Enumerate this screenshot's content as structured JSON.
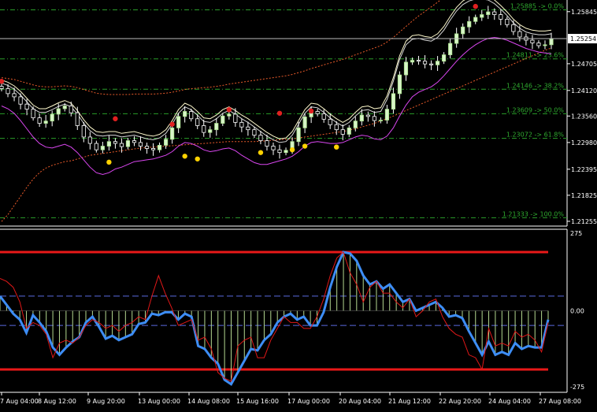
{
  "chart_data": [
    {
      "type": "candlestick",
      "title": "",
      "x_tick_labels": [
        "7 Aug 04:00",
        "8 Aug 12:00",
        "9 Aug 20:00",
        "13 Aug 00:00",
        "14 Aug 08:00",
        "15 Aug 16:00",
        "17 Aug 00:00",
        "20 Aug 04:00",
        "21 Aug 12:00",
        "22 Aug 20:00",
        "24 Aug 04:00",
        "27 Aug 08:00"
      ],
      "y_tick_labels": [
        "1.25845",
        "1.24705",
        "1.24120",
        "1.23560",
        "1.22980",
        "1.22395",
        "1.21825",
        "1.21255"
      ],
      "ylim": [
        1.2115,
        1.261
      ],
      "current_price": "1.25254",
      "fib_levels": [
        {
          "price": 1.25885,
          "label": "1.25885 -> 0.0%"
        },
        {
          "price": 1.24811,
          "label": "1.24811 -> 23.6%"
        },
        {
          "price": 1.24146,
          "label": "1.24146 -> 38.2%"
        },
        {
          "price": 1.23609,
          "label": "1.23609 -> 50.0%"
        },
        {
          "price": 1.23072,
          "label": "1.23072 -> 61.8%"
        },
        {
          "price": 1.21333,
          "label": "1.21333 -> 100.0%"
        }
      ],
      "close_series": [
        1.2416,
        1.2405,
        1.2398,
        1.2382,
        1.2371,
        1.2352,
        1.234,
        1.2345,
        1.236,
        1.2372,
        1.2378,
        1.2363,
        1.2335,
        1.231,
        1.2296,
        1.2282,
        1.229,
        1.23,
        1.2296,
        1.2289,
        1.2302,
        1.2298,
        1.229,
        1.2285,
        1.2282,
        1.2292,
        1.2305,
        1.233,
        1.2355,
        1.2366,
        1.235,
        1.2335,
        1.232,
        1.2326,
        1.234,
        1.2356,
        1.236,
        1.2342,
        1.2332,
        1.2326,
        1.2314,
        1.2302,
        1.229,
        1.2282,
        1.2276,
        1.2281,
        1.23,
        1.233,
        1.2354,
        1.2366,
        1.2361,
        1.2349,
        1.2337,
        1.2326,
        1.2316,
        1.233,
        1.2345,
        1.2358,
        1.2355,
        1.2346,
        1.2347,
        1.2371,
        1.2405,
        1.2446,
        1.2474,
        1.2478,
        1.2476,
        1.247,
        1.2468,
        1.2476,
        1.249,
        1.2515,
        1.2536,
        1.2551,
        1.2563,
        1.2572,
        1.2578,
        1.2584,
        1.2578,
        1.2568,
        1.2556,
        1.2541,
        1.2529,
        1.2522,
        1.2516,
        1.251,
        1.2512,
        1.2525
      ],
      "bollinger_series": [
        {
          "name": "",
          "color": "#fffacd",
          "values": [
            1.2435,
            1.243,
            1.2422,
            1.241,
            1.2395,
            1.238,
            1.2372,
            1.2372,
            1.2378,
            1.2385,
            1.239,
            1.2384,
            1.2368,
            1.2348,
            1.2332,
            1.2322,
            1.232,
            1.2322,
            1.2322,
            1.2318,
            1.232,
            1.2322,
            1.2318,
            1.2314,
            1.2312,
            1.2316,
            1.2326,
            1.2346,
            1.237,
            1.2384,
            1.2378,
            1.2366,
            1.2352,
            1.235,
            1.2358,
            1.237,
            1.2376,
            1.2368,
            1.2358,
            1.235,
            1.234,
            1.233,
            1.232,
            1.2312,
            1.2306,
            1.2308,
            1.2322,
            1.2346,
            1.237,
            1.2384,
            1.2382,
            1.2372,
            1.236,
            1.235,
            1.2342,
            1.235,
            1.2364,
            1.2376,
            1.2378,
            1.2372,
            1.2374,
            1.24,
            1.244,
            1.2488,
            1.252,
            1.2532,
            1.2534,
            1.253,
            1.2528,
            1.2536,
            1.2552,
            1.2574,
            1.2594,
            1.2608,
            1.2616,
            1.262,
            1.262,
            1.2618,
            1.261,
            1.2598,
            1.2584,
            1.2568,
            1.2556,
            1.2548,
            1.2544,
            1.2542,
            1.2542,
            1.2544
          ]
        },
        {
          "name": "",
          "color": "#d9d9d9",
          "values": [
            1.2428,
            1.2423,
            1.2415,
            1.2402,
            1.2387,
            1.2372,
            1.2364,
            1.2364,
            1.237,
            1.2377,
            1.2382,
            1.2376,
            1.236,
            1.234,
            1.2324,
            1.2314,
            1.2312,
            1.2314,
            1.2314,
            1.231,
            1.2312,
            1.2314,
            1.231,
            1.2306,
            1.2304,
            1.2308,
            1.2318,
            1.2338,
            1.2362,
            1.2376,
            1.237,
            1.2358,
            1.2344,
            1.2342,
            1.235,
            1.2362,
            1.2368,
            1.236,
            1.235,
            1.2342,
            1.2332,
            1.2322,
            1.2312,
            1.2304,
            1.2298,
            1.23,
            1.2314,
            1.2338,
            1.2362,
            1.2376,
            1.2374,
            1.2364,
            1.2352,
            1.2342,
            1.2334,
            1.2342,
            1.2356,
            1.2368,
            1.237,
            1.2364,
            1.2366,
            1.2392,
            1.2432,
            1.248,
            1.2512,
            1.2524,
            1.2526,
            1.2522,
            1.252,
            1.2528,
            1.2544,
            1.2566,
            1.2586,
            1.26,
            1.2608,
            1.2612,
            1.2612,
            1.261,
            1.2602,
            1.259,
            1.2576,
            1.256,
            1.2548,
            1.254,
            1.2536,
            1.2534,
            1.2534,
            1.2536
          ]
        },
        {
          "name": "",
          "color": "#d946ef",
          "values": [
            1.2378,
            1.2372,
            1.2362,
            1.2346,
            1.2328,
            1.231,
            1.2296,
            1.2288,
            1.2286,
            1.229,
            1.2294,
            1.2288,
            1.2276,
            1.226,
            1.2244,
            1.2232,
            1.2228,
            1.2232,
            1.224,
            1.2244,
            1.225,
            1.2256,
            1.2258,
            1.226,
            1.2262,
            1.2266,
            1.227,
            1.2278,
            1.229,
            1.2298,
            1.2296,
            1.229,
            1.2282,
            1.2278,
            1.228,
            1.2284,
            1.2286,
            1.228,
            1.227,
            1.2262,
            1.2254,
            1.225,
            1.225,
            1.2254,
            1.2258,
            1.2262,
            1.2268,
            1.2278,
            1.229,
            1.2298,
            1.23,
            1.2298,
            1.2296,
            1.2296,
            1.2298,
            1.2304,
            1.231,
            1.2314,
            1.2312,
            1.2306,
            1.2304,
            1.2312,
            1.233,
            1.2356,
            1.238,
            1.2398,
            1.2408,
            1.2414,
            1.242,
            1.243,
            1.2444,
            1.246,
            1.2476,
            1.249,
            1.2502,
            1.2512,
            1.252,
            1.2526,
            1.2528,
            1.2526,
            1.2522,
            1.2516,
            1.251,
            1.2504,
            1.25,
            1.2496,
            1.2494,
            1.2492
          ]
        }
      ],
      "envelope_series": [
        {
          "name": "",
          "color": "#e85a2a",
          "values": [
            1.2125,
            1.214,
            1.216,
            1.218,
            1.22,
            1.2218,
            1.2232,
            1.2242,
            1.2248,
            1.2252,
            1.2256,
            1.2258,
            1.2262,
            1.2266,
            1.227,
            1.2272,
            1.2274,
            1.2276,
            1.2278,
            1.228,
            1.2282,
            1.2284,
            1.2286,
            1.2287,
            1.2288,
            1.2289,
            1.229,
            1.2291,
            1.2292,
            1.2293,
            1.2294,
            1.2295,
            1.2296,
            1.2297,
            1.2298,
            1.2299,
            1.23,
            1.23,
            1.23,
            1.23,
            1.23,
            1.2301,
            1.2302,
            1.2303,
            1.2304,
            1.2305,
            1.2306,
            1.2308,
            1.231,
            1.2312,
            1.2314,
            1.2316,
            1.2318,
            1.232,
            1.2322,
            1.2325,
            1.2328,
            1.2332,
            1.2336,
            1.234,
            1.2345,
            1.235,
            1.2356,
            1.2362,
            1.2368,
            1.2374,
            1.238,
            1.2386,
            1.2392,
            1.2398,
            1.2404,
            1.241,
            1.2416,
            1.2422,
            1.2428,
            1.2434,
            1.244,
            1.2446,
            1.2452,
            1.2458,
            1.2464,
            1.247,
            1.2476,
            1.2482,
            1.2488,
            1.2494,
            1.25,
            1.2505
          ]
        },
        {
          "name": "",
          "color": "#e85a2a",
          "values": [
            1.244,
            1.2438,
            1.2436,
            1.2432,
            1.2428,
            1.2424,
            1.2421,
            1.242,
            1.242,
            1.2421,
            1.2422,
            1.2421,
            1.2418,
            1.2414,
            1.241,
            1.2406,
            1.2404,
            1.2403,
            1.2403,
            1.2403,
            1.2403,
            1.2404,
            1.2404,
            1.2404,
            1.2404,
            1.2405,
            1.2406,
            1.2408,
            1.2411,
            1.2414,
            1.2416,
            1.2417,
            1.2418,
            1.2419,
            1.2421,
            1.2423,
            1.2426,
            1.2428,
            1.243,
            1.2432,
            1.2434,
            1.2436,
            1.2438,
            1.244,
            1.2442,
            1.2444,
            1.2447,
            1.2451,
            1.2455,
            1.246,
            1.2464,
            1.2468,
            1.2472,
            1.2476,
            1.248,
            1.2485,
            1.249,
            1.2495,
            1.25,
            1.2505,
            1.251,
            1.2518,
            1.2528,
            1.254,
            1.2552,
            1.2564,
            1.2575,
            1.2585,
            1.2595,
            1.2605,
            1.2616,
            1.2628,
            1.264,
            1.2652,
            1.2662,
            1.2672,
            1.268,
            1.2688,
            1.2695,
            1.27,
            1.2704,
            1.2708,
            1.271,
            1.2712,
            1.2714,
            1.2715,
            1.2716,
            1.2717
          ]
        }
      ],
      "markers": [
        {
          "i": 0,
          "price": 1.2432,
          "color": "#e02020"
        },
        {
          "i": 18,
          "price": 1.235,
          "color": "#e02020"
        },
        {
          "i": 27,
          "price": 1.2338,
          "color": "#e02020"
        },
        {
          "i": 36,
          "price": 1.237,
          "color": "#e02020"
        },
        {
          "i": 44,
          "price": 1.2362,
          "color": "#e02020"
        },
        {
          "i": 17,
          "price": 1.2255,
          "color": "#ffd200"
        },
        {
          "i": 29,
          "price": 1.2268,
          "color": "#ffd200"
        },
        {
          "i": 31,
          "price": 1.2262,
          "color": "#ffd200"
        },
        {
          "i": 41,
          "price": 1.2276,
          "color": "#ffd200"
        },
        {
          "i": 46,
          "price": 1.2282,
          "color": "#ffd200"
        },
        {
          "i": 48,
          "price": 1.229,
          "color": "#ffd200"
        },
        {
          "i": 53,
          "price": 1.2288,
          "color": "#ffd200"
        },
        {
          "i": 49,
          "price": 1.2367,
          "color": "#e02020"
        },
        {
          "i": 75,
          "price": 1.2596,
          "color": "#e02020"
        }
      ]
    },
    {
      "type": "line",
      "title": "",
      "y_tick_labels": [
        "275",
        "0.00",
        "-275"
      ],
      "ylim": [
        -275,
        275
      ],
      "levels": [
        {
          "value": 200,
          "color": "#e81818",
          "style": "solid"
        },
        {
          "value": 50,
          "color": "#5a6ae0",
          "style": "dashed"
        },
        {
          "value": -50,
          "color": "#5a6ae0",
          "style": "dashed"
        },
        {
          "value": -200,
          "color": "#e81818",
          "style": "solid"
        }
      ],
      "series": [
        {
          "name": "",
          "color": "#3d8df5",
          "values": [
            50,
            20,
            -10,
            -30,
            -75,
            -15,
            -40,
            -70,
            -125,
            -150,
            -125,
            -105,
            -90,
            -40,
            -20,
            -55,
            -95,
            -85,
            -100,
            -90,
            -80,
            -45,
            -40,
            -10,
            -15,
            -5,
            -5,
            -30,
            -10,
            -20,
            -120,
            -130,
            -160,
            -180,
            -235,
            -250,
            -210,
            -170,
            -130,
            -135,
            -100,
            -80,
            -40,
            -20,
            -10,
            -30,
            -20,
            -50,
            -50,
            -5,
            80,
            150,
            200,
            195,
            170,
            120,
            90,
            100,
            75,
            90,
            60,
            30,
            40,
            0,
            10,
            20,
            30,
            10,
            -20,
            -15,
            -25,
            -70,
            -110,
            -150,
            -105,
            -150,
            -140,
            -150,
            -110,
            -130,
            -120,
            -125,
            -125,
            -30
          ]
        },
        {
          "name": "",
          "color": "#e01818",
          "values": [
            110,
            100,
            80,
            30,
            -60,
            -40,
            -50,
            -80,
            -160,
            -110,
            -100,
            -110,
            -90,
            -50,
            -30,
            -40,
            -60,
            -50,
            -70,
            -50,
            -40,
            -20,
            -30,
            50,
            120,
            60,
            10,
            -50,
            -40,
            -30,
            -100,
            -90,
            -130,
            -210,
            -230,
            -240,
            -120,
            -100,
            -90,
            -160,
            -160,
            -100,
            -60,
            -20,
            -40,
            -40,
            -60,
            -60,
            -20,
            40,
            120,
            180,
            200,
            130,
            90,
            30,
            80,
            100,
            60,
            60,
            30,
            10,
            40,
            -20,
            0,
            30,
            40,
            -20,
            -60,
            -80,
            -90,
            -150,
            -160,
            -200,
            -60,
            -120,
            -110,
            -120,
            -70,
            -90,
            -80,
            -100,
            -140,
            -40
          ]
        },
        {
          "name": "",
          "color": "#b5d991",
          "type": "histogram",
          "values": [
            50,
            20,
            -10,
            -30,
            -75,
            -15,
            -40,
            -70,
            -125,
            -150,
            -125,
            -105,
            -90,
            -40,
            -20,
            -55,
            -95,
            -85,
            -100,
            -90,
            -80,
            -45,
            -40,
            -10,
            -15,
            -5,
            -5,
            -30,
            -10,
            -20,
            -120,
            -130,
            -160,
            -180,
            -235,
            -250,
            -210,
            -170,
            -130,
            -135,
            -100,
            -80,
            -40,
            -20,
            -10,
            -30,
            -20,
            -50,
            -50,
            -5,
            80,
            150,
            200,
            195,
            170,
            120,
            90,
            100,
            75,
            90,
            60,
            30,
            40,
            0,
            10,
            20,
            30,
            10,
            -20,
            -15,
            -25,
            -70,
            -110,
            -150,
            -105,
            -150,
            -140,
            -150,
            -110,
            -130,
            -120,
            -125,
            -125,
            -30
          ]
        }
      ]
    }
  ]
}
